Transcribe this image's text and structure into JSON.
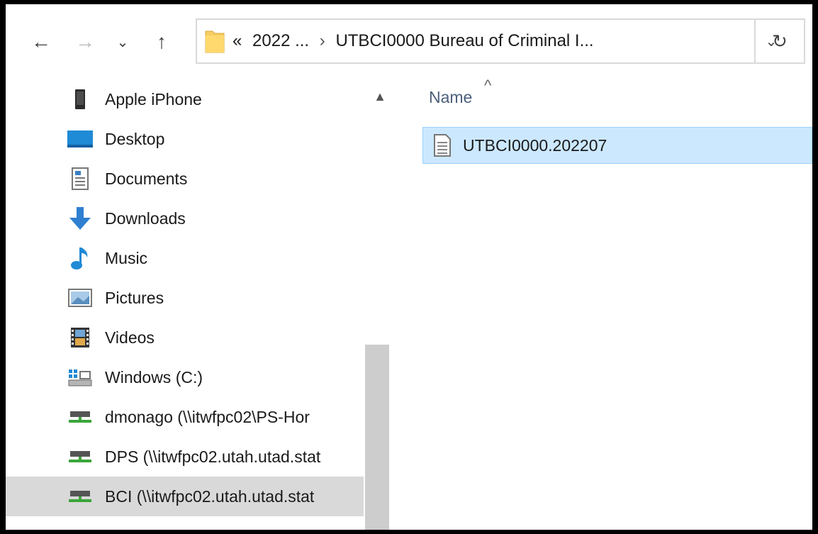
{
  "toolbar": {
    "back_glyph": "←",
    "forward_glyph": "→",
    "recent_glyph": "⌄",
    "up_glyph": "↑",
    "refresh_glyph": "↻",
    "dropdown_glyph": "⌄"
  },
  "address": {
    "overflow": "«",
    "segment1": "2022 ...",
    "separator": "›",
    "segment2": "UTBCI0000 Bureau of Criminal I..."
  },
  "navigation": {
    "items": [
      {
        "label": "Apple iPhone",
        "icon": "phone-icon"
      },
      {
        "label": "Desktop",
        "icon": "desktop-icon"
      },
      {
        "label": "Documents",
        "icon": "documents-icon"
      },
      {
        "label": "Downloads",
        "icon": "downloads-icon"
      },
      {
        "label": "Music",
        "icon": "music-icon"
      },
      {
        "label": "Pictures",
        "icon": "pictures-icon"
      },
      {
        "label": "Videos",
        "icon": "videos-icon"
      },
      {
        "label": "Windows (C:)",
        "icon": "drive-icon"
      },
      {
        "label": "dmonago (\\\\itwfpc02\\PS-Hor",
        "icon": "network-drive-icon"
      },
      {
        "label": "DPS (\\\\itwfpc02.utah.utad.stat",
        "icon": "network-drive-icon"
      },
      {
        "label": "BCI (\\\\itwfpc02.utah.utad.stat",
        "icon": "network-drive-icon",
        "selected": true
      }
    ]
  },
  "content": {
    "column_name": "Name",
    "sort_glyph": "^",
    "files": [
      {
        "name": "UTBCI0000.202207",
        "selected": true
      }
    ]
  },
  "colors": {
    "selection_bg": "#cce8ff",
    "selection_border": "#99d1ff",
    "nav_selected_bg": "#d9d9d9",
    "column_header": "#4c607a"
  }
}
